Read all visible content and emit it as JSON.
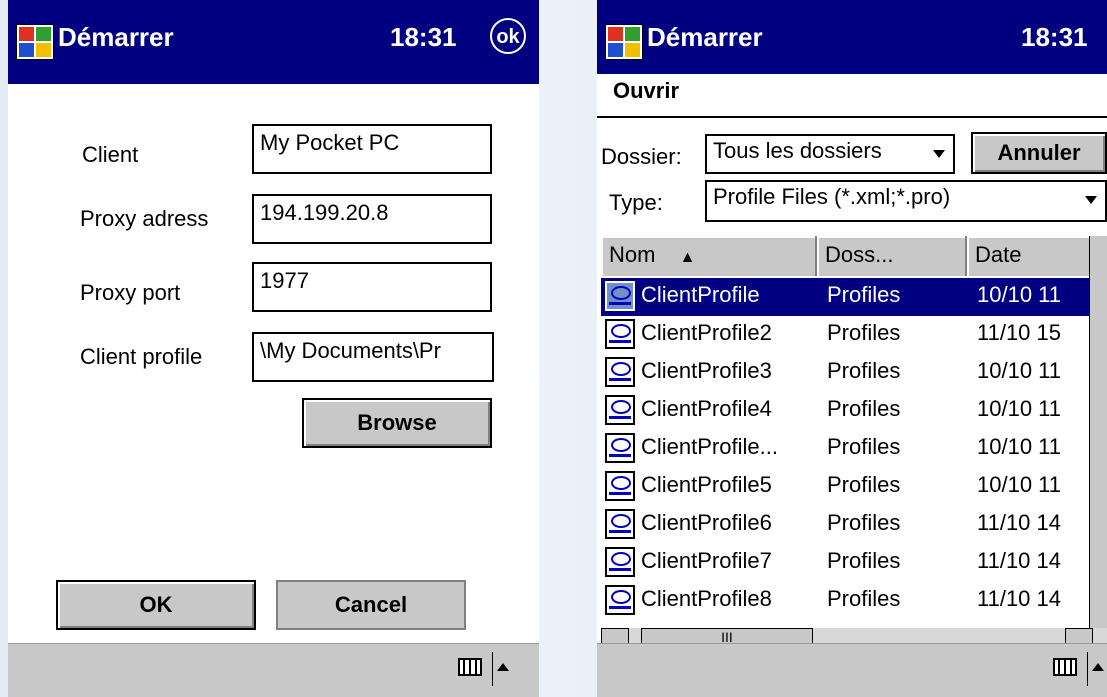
{
  "left_screen": {
    "title": "Démarrer",
    "time": "18:31",
    "ok_label": "ok",
    "fields": [
      {
        "label": "Client",
        "value": "My Pocket PC"
      },
      {
        "label": "Proxy adress",
        "value": "194.199.20.8"
      },
      {
        "label": "Proxy port",
        "value": "1977"
      },
      {
        "label": "Client profile",
        "value": "\\My Documents\\Pr"
      }
    ],
    "browse_label": "Browse",
    "ok_button": "OK",
    "cancel_button": "Cancel"
  },
  "right_screen": {
    "title": "Démarrer",
    "time": "18:31",
    "dialog_title": "Ouvrir",
    "folder_label": "Dossier:",
    "folder_value": "Tous les dossiers",
    "cancel_label": "Annuler",
    "type_label": "Type:",
    "type_value": "Profile Files (*.xml;*.pro)",
    "columns": [
      "Nom",
      "Doss...",
      "Date"
    ],
    "sort_indicator": "▲",
    "files": [
      {
        "name": "ClientProfile",
        "folder": "Profiles",
        "date": "10/10 11"
      },
      {
        "name": "ClientProfile2",
        "folder": "Profiles",
        "date": "11/10 15"
      },
      {
        "name": "ClientProfile3",
        "folder": "Profiles",
        "date": "10/10 11"
      },
      {
        "name": "ClientProfile4",
        "folder": "Profiles",
        "date": "10/10 11"
      },
      {
        "name": "ClientProfile...",
        "folder": "Profiles",
        "date": "10/10 11"
      },
      {
        "name": "ClientProfile5",
        "folder": "Profiles",
        "date": "10/10 11"
      },
      {
        "name": "ClientProfile6",
        "folder": "Profiles",
        "date": "11/10 14"
      },
      {
        "name": "ClientProfile7",
        "folder": "Profiles",
        "date": "11/10 14"
      },
      {
        "name": "ClientProfile8",
        "folder": "Profiles",
        "date": "11/10 14"
      }
    ],
    "selected_index": 0,
    "scroll_thumb_label": "III"
  },
  "colors": {
    "titlebar": "#000080",
    "selection": "#000080",
    "chrome": "#c8c8c8"
  }
}
